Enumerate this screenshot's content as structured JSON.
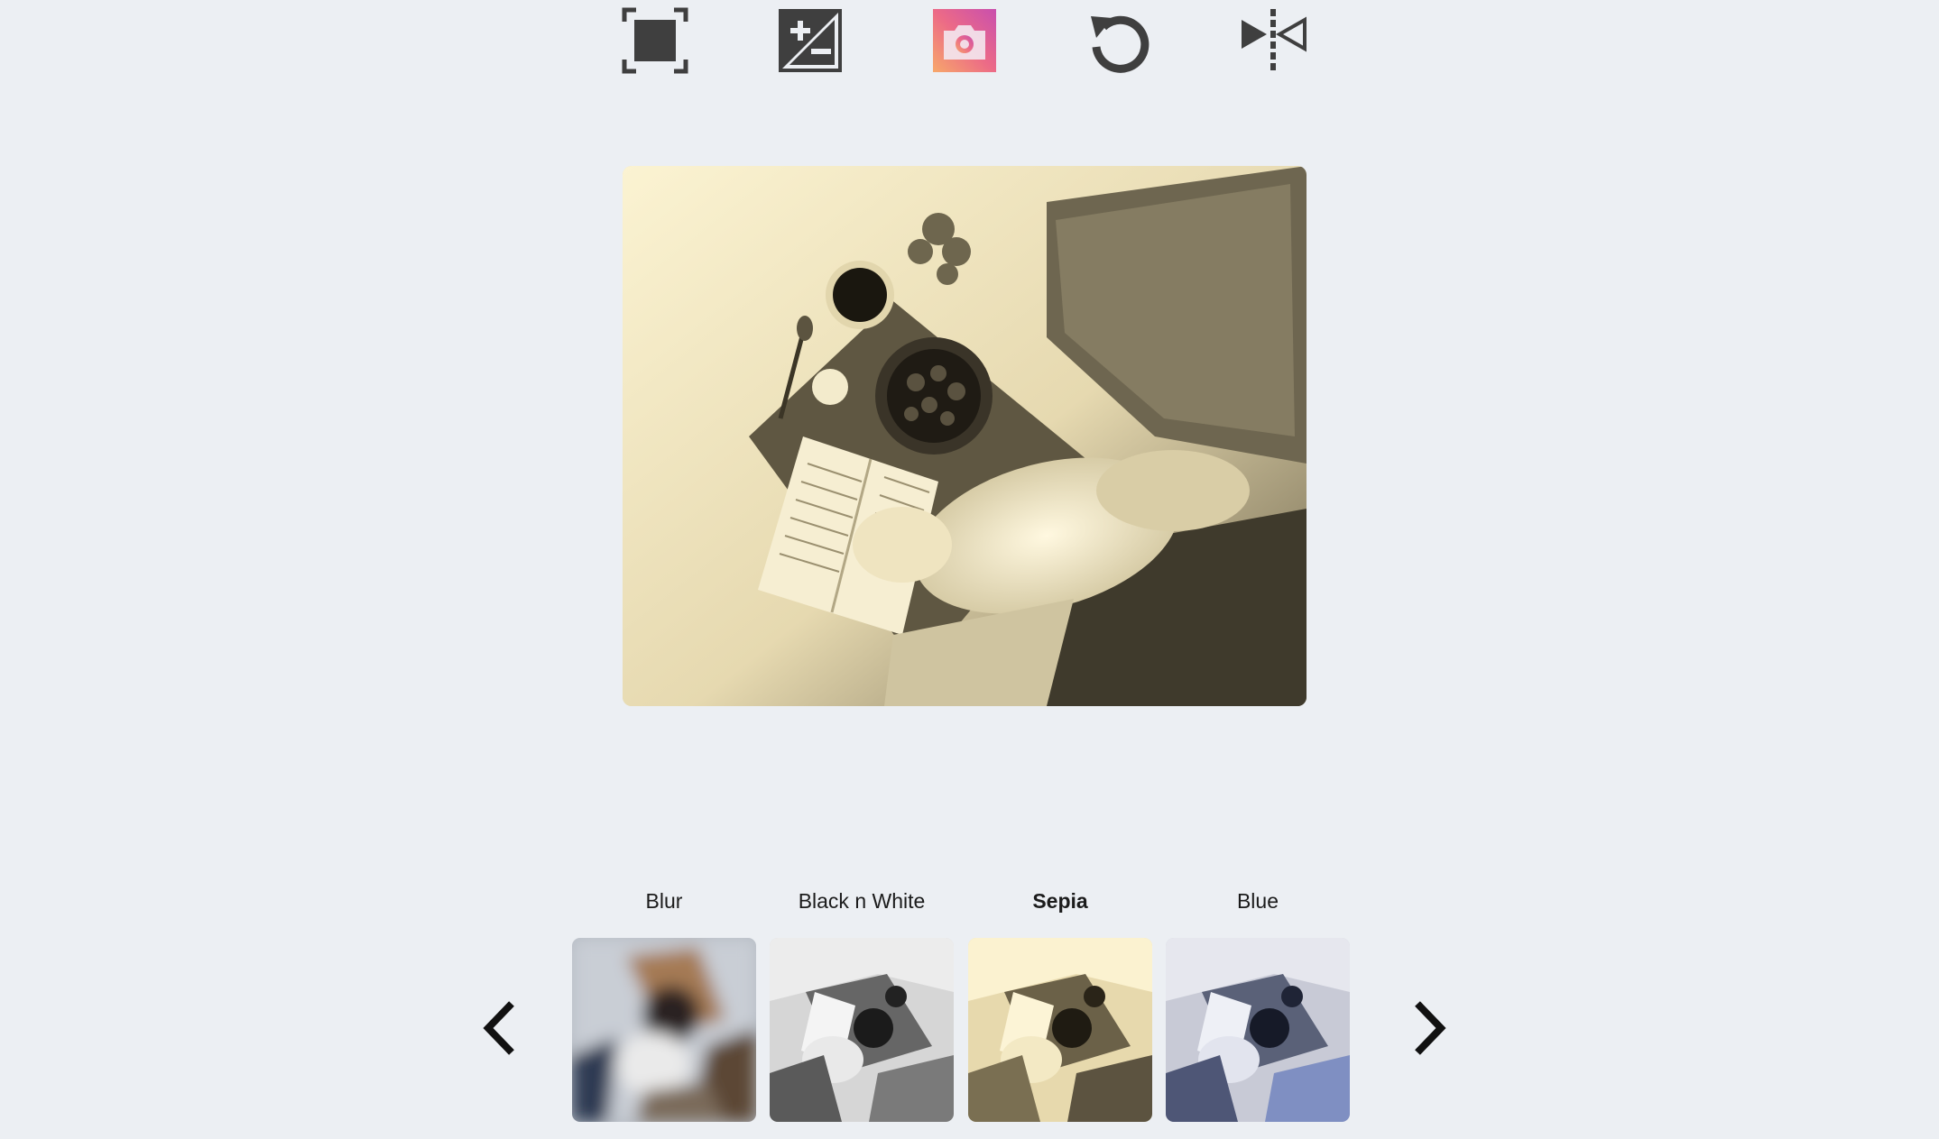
{
  "toolbar": {
    "tools": [
      {
        "icon": "crop-icon",
        "active": false
      },
      {
        "icon": "exposure-icon",
        "active": false
      },
      {
        "icon": "filter-icon",
        "active": true
      },
      {
        "icon": "rotate-icon",
        "active": false
      },
      {
        "icon": "flip-icon",
        "active": false
      }
    ],
    "icon_color": "#3f3f3f",
    "active_gradient": [
      "#f28a6b",
      "#d64e9e"
    ]
  },
  "preview": {
    "filter_applied": "Sepia"
  },
  "filters": {
    "items": [
      {
        "label": "Blur",
        "selected": false
      },
      {
        "label": "Black n White",
        "selected": false
      },
      {
        "label": "Sepia",
        "selected": true
      },
      {
        "label": "Blue",
        "selected": false
      }
    ],
    "prev_icon": "chevron-left-icon",
    "next_icon": "chevron-right-icon"
  },
  "colors": {
    "background": "#eceff3",
    "sepia_light": "#fbf3d2",
    "sepia_dark": "#4e4632",
    "bw_dark": "#3a3a3a",
    "blue_tint": "#7f8fc2"
  }
}
